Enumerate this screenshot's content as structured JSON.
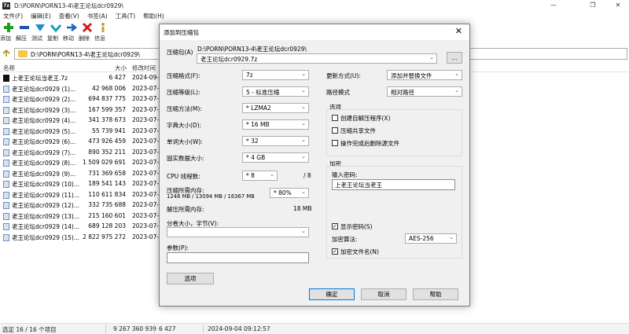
{
  "window": {
    "title": "D:\\PORN\\PORN13-4\\老王论坛dcr0929\\",
    "app_icon": "7z"
  },
  "menu": [
    "文件(F)",
    "编辑(E)",
    "查看(V)",
    "书签(A)",
    "工具(T)",
    "帮助(H)"
  ],
  "toolbar": [
    {
      "label": "添加",
      "icon": "add-icon"
    },
    {
      "label": "解压",
      "icon": "extract-icon"
    },
    {
      "label": "测试",
      "icon": "test-icon"
    },
    {
      "label": "复制",
      "icon": "copy-icon"
    },
    {
      "label": "移动",
      "icon": "move-icon"
    },
    {
      "label": "删除",
      "icon": "delete-icon"
    },
    {
      "label": "信息",
      "icon": "info-icon"
    }
  ],
  "address": {
    "path": "D:\\PORN\\PORN13-4\\老王论坛dcr0929\\"
  },
  "file_columns": {
    "name": "名称",
    "size": "大小",
    "modified": "修改时间"
  },
  "files": [
    {
      "name": "上老王论坛当老王.7z",
      "size": "6 427",
      "date": "2024-09-0",
      "type": "7z"
    },
    {
      "name": "老王论坛dcr0929 (1)...",
      "size": "42 968 006",
      "date": "2023-07-2",
      "type": "file"
    },
    {
      "name": "老王论坛dcr0929 (2)...",
      "size": "694 837 775",
      "date": "2023-07-2",
      "type": "file"
    },
    {
      "name": "老王论坛dcr0929 (3)...",
      "size": "167 599 357",
      "date": "2023-07-2",
      "type": "file"
    },
    {
      "name": "老王论坛dcr0929 (4)...",
      "size": "341 378 673",
      "date": "2023-07-2",
      "type": "file"
    },
    {
      "name": "老王论坛dcr0929 (5)...",
      "size": "55 739 941",
      "date": "2023-07-2",
      "type": "file"
    },
    {
      "name": "老王论坛dcr0929 (6)...",
      "size": "473 926 459",
      "date": "2023-07-2",
      "type": "file"
    },
    {
      "name": "老王论坛dcr0929 (7)...",
      "size": "890 352 211",
      "date": "2023-07-2",
      "type": "file"
    },
    {
      "name": "老王论坛dcr0929 (8)...",
      "size": "1 509 029 691",
      "date": "2023-07-2",
      "type": "file"
    },
    {
      "name": "老王论坛dcr0929 (9)...",
      "size": "731 369 658",
      "date": "2023-07-2",
      "type": "file"
    },
    {
      "name": "老王论坛dcr0929 (10)...",
      "size": "189 541 143",
      "date": "2023-07-2",
      "type": "file"
    },
    {
      "name": "老王论坛dcr0929 (11)...",
      "size": "110 611 834",
      "date": "2023-07-2",
      "type": "file"
    },
    {
      "name": "老王论坛dcr0929 (12)...",
      "size": "332 735 688",
      "date": "2023-07-2",
      "type": "file"
    },
    {
      "name": "老王论坛dcr0929 (13)...",
      "size": "215 160 601",
      "date": "2023-07-2",
      "type": "file"
    },
    {
      "name": "老王论坛dcr0929 (14)...",
      "size": "689 128 203",
      "date": "2023-07-2",
      "type": "file"
    },
    {
      "name": "老王论坛dcr0929 (15)...",
      "size": "2 822 975 272",
      "date": "2023-07-2",
      "type": "file"
    }
  ],
  "status": {
    "selection": "选定 16 / 16 个项目",
    "total_size": "9 267 360 939",
    "selected_size": "6 427",
    "modified": "2024-09-04 09:12:57"
  },
  "dialog": {
    "title": "添加到压缩包",
    "close": "✕",
    "archive_label": "压缩包(A)",
    "archive_dir": "D:\\PORN\\PORN13-4\\老王论坛dcr0929\\",
    "archive_name": "老王论坛dcr0929.7z",
    "browse": "...",
    "format_label": "压缩格式(F):",
    "format_value": "7z",
    "level_label": "压缩等级(L):",
    "level_value": "5 - 标准压缩",
    "method_label": "压缩方法(M):",
    "method_value": "* LZMA2",
    "dict_label": "字典大小(D):",
    "dict_value": "* 16 MB",
    "word_label": "单词大小(W):",
    "word_value": "* 32",
    "solid_label": "固实数据大小:",
    "solid_value": "* 4 GB",
    "threads_label": "CPU 线程数:",
    "threads_value": "* 8",
    "threads_total": "/ 8",
    "mem_comp_label": "压缩所需内存:",
    "mem_comp_detail": "1248 MB / 13094 MB / 16367 MB",
    "mem_comp_value": "* 80%",
    "mem_decomp_label": "解压所需内存:",
    "mem_decomp_value": "18 MB",
    "split_label": "分卷大小，字节(V):",
    "split_value": "",
    "params_label": "参数(P):",
    "params_value": "",
    "options_button": "选项",
    "update_label": "更新方式(U):",
    "update_value": "添加并替换文件",
    "pathmode_label": "路径模式",
    "pathmode_value": "相对路径",
    "options_group": "选项",
    "opt_sfx": "创建自解压程序(X)",
    "opt_shared": "压缩共享文件",
    "opt_delete": "操作完成后删除源文件",
    "encrypt_group": "加密",
    "password_label": "输入密码:",
    "password_value": "上老王论坛当老王",
    "show_password": "显示密码(S)",
    "method_enc_label": "加密算法:",
    "method_enc_value": "AES-256",
    "encrypt_names": "加密文件名(N)",
    "ok": "确定",
    "cancel": "取消",
    "help": "帮助"
  }
}
